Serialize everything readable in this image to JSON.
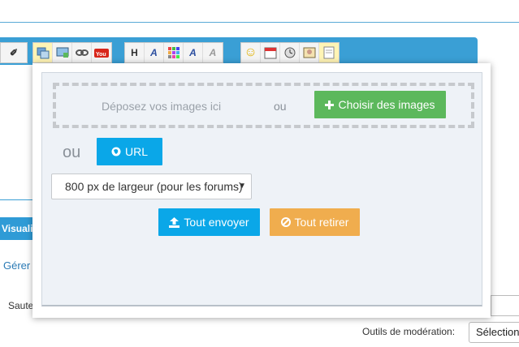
{
  "editor": {
    "toolbar_left": [
      "✐"
    ],
    "toolbar_group1": [
      "img",
      "img-host",
      "link",
      "YouTube"
    ],
    "toolbar_group2": [
      "H",
      "A",
      "#",
      "A",
      "A"
    ],
    "toolbar_group3": [
      "☺",
      "cal",
      "clock",
      "pic",
      "doc"
    ],
    "tab_visualiser": "Visualis",
    "link_gerer": "Gérer",
    "label_saute": "Saute",
    "moderation_label": "Outils de modération:",
    "moderation_select": "Sélection"
  },
  "upload": {
    "drop_text": "Déposez vos images ici",
    "ou_small": "ou",
    "choose_button": "Choisir des images",
    "ou_large": "ou",
    "url_button": "URL",
    "size_select": "800 px de largeur (pour les forums)",
    "send_all_button": "Tout envoyer",
    "remove_all_button": "Tout retirer"
  },
  "colors": {
    "accent": "#3a9fd5",
    "green": "#5cb85c",
    "blue": "#0aa7e8",
    "orange": "#f0ad4e"
  }
}
